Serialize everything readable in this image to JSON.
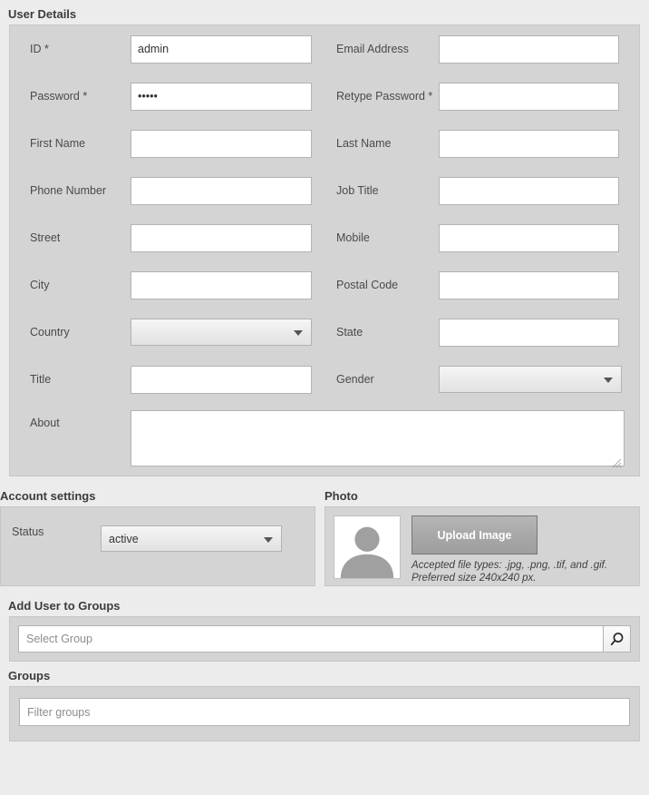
{
  "sections": {
    "user_details": "User Details",
    "account_settings": "Account settings",
    "photo": "Photo",
    "add_user_to_groups": "Add User to Groups",
    "groups": "Groups"
  },
  "user_details": {
    "rows": [
      {
        "left": {
          "label": "ID *",
          "value": "admin",
          "type": "text"
        },
        "right": {
          "label": "Email Address",
          "value": "",
          "type": "text"
        }
      },
      {
        "left": {
          "label": "Password *",
          "value": "•••••",
          "type": "password"
        },
        "right": {
          "label": "Retype Password *",
          "value": "",
          "type": "password"
        }
      },
      {
        "left": {
          "label": "First Name",
          "value": "",
          "type": "text"
        },
        "right": {
          "label": "Last Name",
          "value": "",
          "type": "text"
        }
      },
      {
        "left": {
          "label": "Phone Number",
          "value": "",
          "type": "text"
        },
        "right": {
          "label": "Job Title",
          "value": "",
          "type": "text"
        }
      },
      {
        "left": {
          "label": "Street",
          "value": "",
          "type": "text"
        },
        "right": {
          "label": "Mobile",
          "value": "",
          "type": "text"
        }
      },
      {
        "left": {
          "label": "City",
          "value": "",
          "type": "text"
        },
        "right": {
          "label": "Postal Code",
          "value": "",
          "type": "text"
        }
      },
      {
        "left": {
          "label": "Country",
          "value": "",
          "type": "select"
        },
        "right": {
          "label": "State",
          "value": "",
          "type": "text"
        }
      },
      {
        "left": {
          "label": "Title",
          "value": "",
          "type": "text"
        },
        "right": {
          "label": "Gender",
          "value": "",
          "type": "select"
        }
      }
    ],
    "about": {
      "label": "About",
      "value": ""
    }
  },
  "account_settings": {
    "status_label": "Status",
    "status_value": "active"
  },
  "photo": {
    "upload_button": "Upload Image",
    "hint_line1": "Accepted file types: .jpg, .png, .tif, and .gif.",
    "hint_line2": "Preferred size 240x240 px.",
    "avatar_icon": "user-silhouette-icon"
  },
  "add_user_to_groups": {
    "placeholder": "Select Group",
    "value": "",
    "search_icon": "search-icon"
  },
  "groups": {
    "filter_placeholder": "Filter groups",
    "filter_value": ""
  },
  "colors": {
    "page_background": "#ececec",
    "panel_background": "#d4d4d4",
    "panel_border": "#c6c6c6",
    "field_border": "#b3b3b3",
    "heading_text": "#3c3c3c",
    "label_text": "#4a4a4a",
    "placeholder_text": "#8d8d8d",
    "button_text": "#ffffff",
    "avatar_silhouette": "#a0a0a0"
  }
}
